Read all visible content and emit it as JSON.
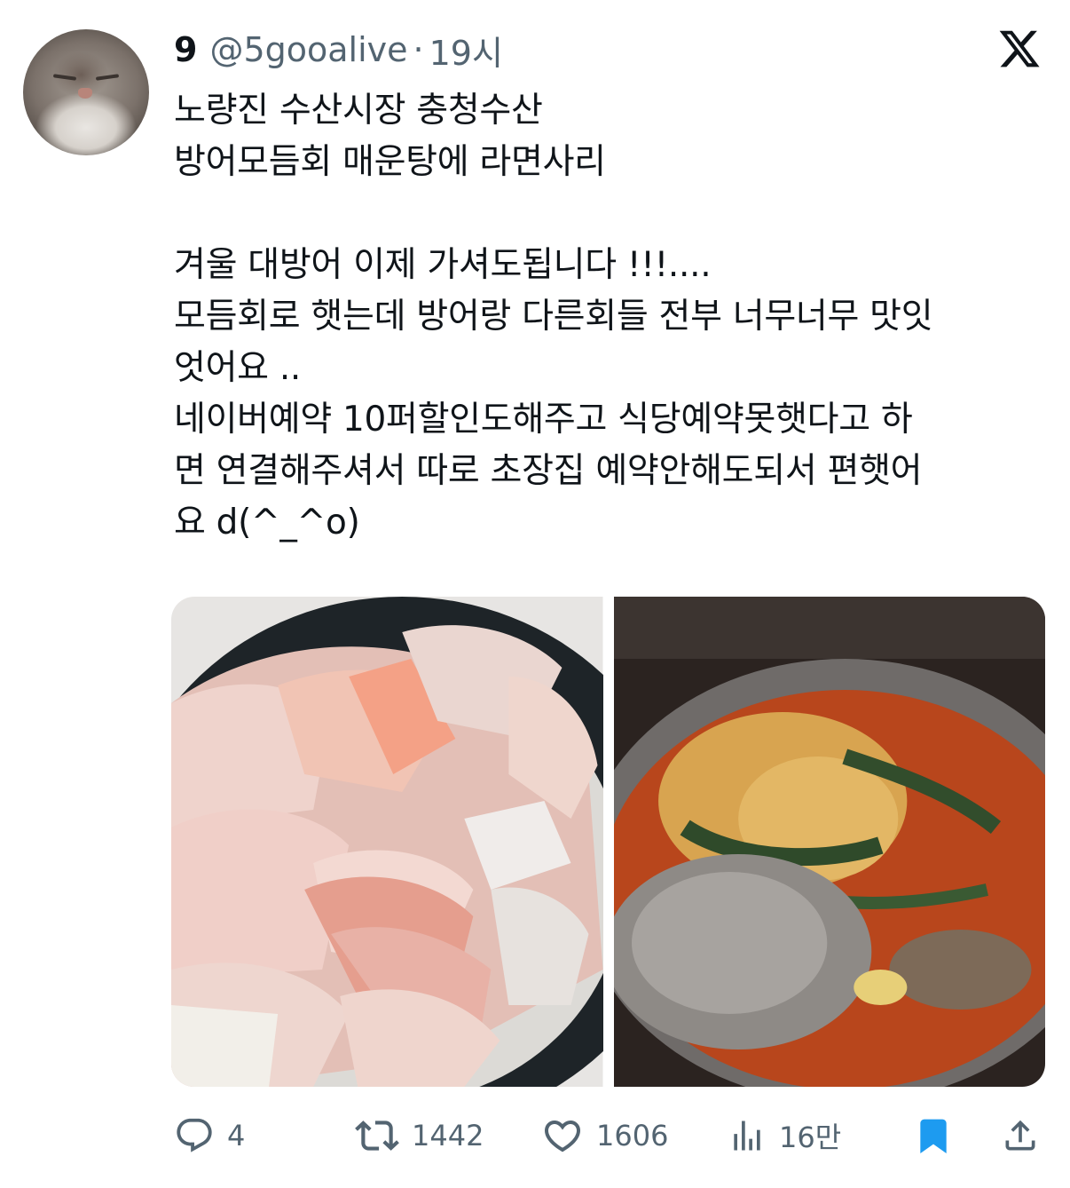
{
  "tweet": {
    "author_name": "9",
    "handle": "@5gooalive",
    "separator": "·",
    "time": "19시",
    "text": "노량진 수산시장 충청수산\n방어모듬회 매운탕에 라면사리\n\n겨울 대방어 이제 가셔도됩니다 !!!....\n모듬회로 햇는데 방어랑 다른회들 전부 너무너무 맛잇\n엇어요 ..\n네이버예약 10퍼할인도해주고 식당예약못햇다고 하\n면 연결해주셔서 따로 초장집 예약안해도되서 편햇어\n요 d(^_^o)"
  },
  "media": [
    {
      "icon": "sashimi-platter-photo"
    },
    {
      "icon": "spicy-fish-stew-with-ramen-photo"
    }
  ],
  "actions": {
    "reply_count": "4",
    "retweet_count": "1442",
    "like_count": "1606",
    "views_count": "16만"
  },
  "colors": {
    "text": "#0f1419",
    "secondary": "#536471",
    "bookmark_active": "#1d9bf0"
  }
}
